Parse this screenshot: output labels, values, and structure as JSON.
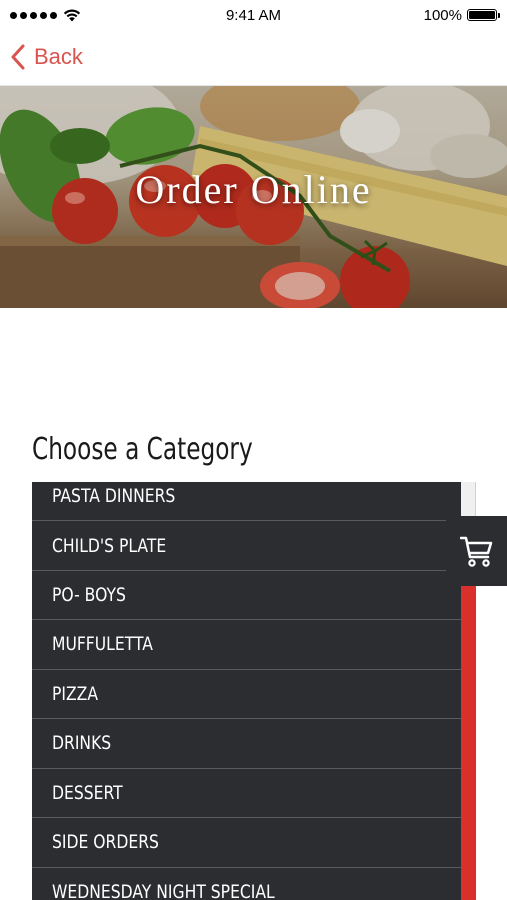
{
  "status_bar": {
    "time": "9:41 AM",
    "battery": "100%"
  },
  "nav": {
    "back_label": "Back"
  },
  "hero": {
    "title": "Order Online"
  },
  "category": {
    "heading": "Choose a Category",
    "items": [
      "PASTA DINNERS",
      "CHILD'S PLATE",
      "PO- BOYS",
      "MUFFULETTA",
      "PIZZA",
      "DRINKS",
      "DESSERT",
      "SIDE ORDERS",
      "WEDNESDAY NIGHT SPECIAL"
    ]
  },
  "colors": {
    "accent": "#d9534f",
    "list_background": "#2b2d30",
    "scroll_track": "#d9302c"
  },
  "icons": {
    "back": "chevron-left-icon",
    "cart": "shopping-cart-icon",
    "signal": "signal-dots-icon",
    "wifi": "wifi-icon",
    "battery": "battery-icon"
  }
}
